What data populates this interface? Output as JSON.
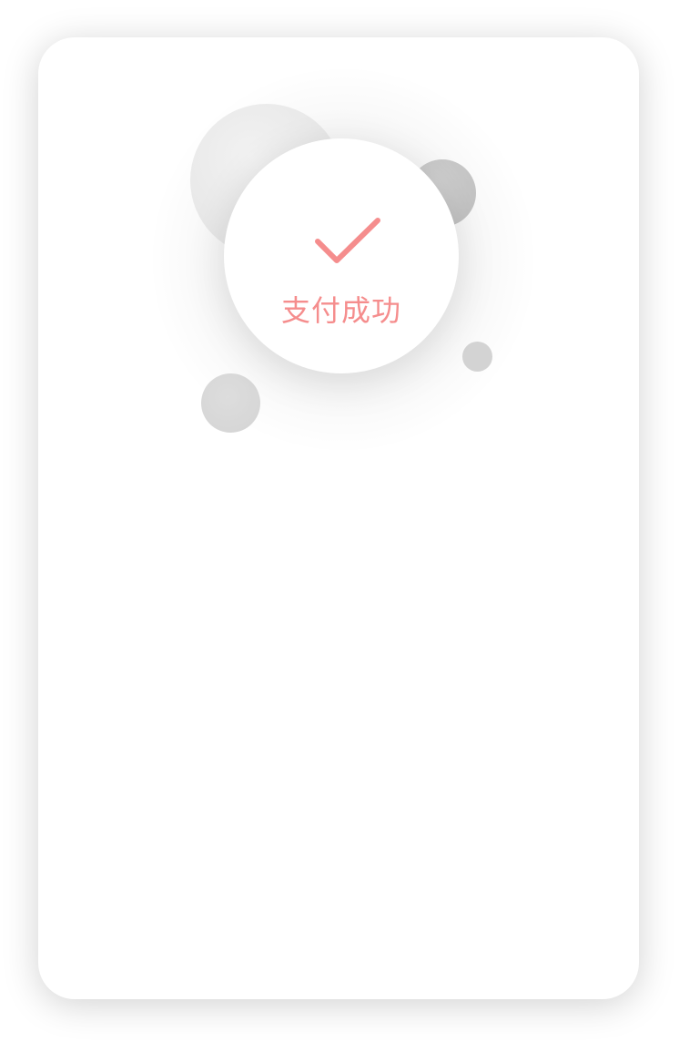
{
  "status": {
    "message": "支付成功",
    "icon": "checkmark-icon"
  },
  "colors": {
    "accent": "#f58d8d",
    "card_background": "#ffffff",
    "bubble_light": "#e6e6e6",
    "bubble_dark": "#bdbdbd",
    "bubble_small": "#d3d3d3"
  }
}
